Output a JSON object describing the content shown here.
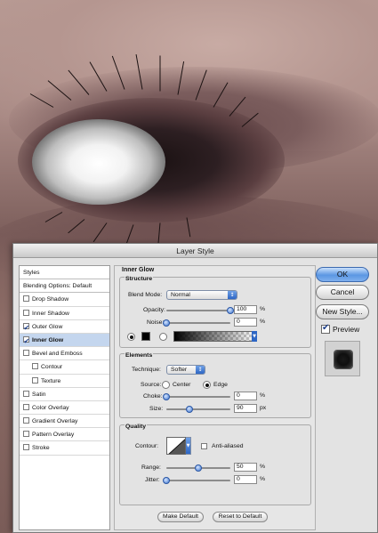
{
  "dialog": {
    "title": "Layer Style"
  },
  "styles_list": [
    {
      "label": "Styles",
      "type": "header",
      "checked": false
    },
    {
      "label": "Blending Options: Default",
      "type": "header",
      "checked": false
    },
    {
      "label": "Drop Shadow",
      "type": "item",
      "checked": false
    },
    {
      "label": "Inner Shadow",
      "type": "item",
      "checked": false
    },
    {
      "label": "Outer Glow",
      "type": "item",
      "checked": true
    },
    {
      "label": "Inner Glow",
      "type": "item",
      "checked": true,
      "selected": true
    },
    {
      "label": "Bevel and Emboss",
      "type": "item",
      "checked": false
    },
    {
      "label": "Contour",
      "type": "sub",
      "checked": false
    },
    {
      "label": "Texture",
      "type": "sub",
      "checked": false
    },
    {
      "label": "Satin",
      "type": "item",
      "checked": false
    },
    {
      "label": "Color Overlay",
      "type": "item",
      "checked": false
    },
    {
      "label": "Gradient Overlay",
      "type": "item",
      "checked": false
    },
    {
      "label": "Pattern Overlay",
      "type": "item",
      "checked": false
    },
    {
      "label": "Stroke",
      "type": "item",
      "checked": false
    }
  ],
  "panel": {
    "title": "Inner Glow",
    "structure": {
      "title": "Structure",
      "blend_mode_label": "Blend Mode:",
      "blend_mode_value": "Normal",
      "opacity_label": "Opacity:",
      "opacity_value": "100",
      "opacity_level": 1.0,
      "noise_label": "Noise:",
      "noise_value": "0",
      "noise_level": 0.0,
      "percent": "%",
      "glow_color": "#000000"
    },
    "elements": {
      "title": "Elements",
      "technique_label": "Technique:",
      "technique_value": "Softer",
      "source_label": "Source:",
      "source_center": "Center",
      "source_edge": "Edge",
      "source_selected": "Edge",
      "choke_label": "Choke:",
      "choke_value": "0",
      "choke_level": 0.0,
      "size_label": "Size:",
      "size_value": "90",
      "size_level": 0.36,
      "percent": "%",
      "px": "px"
    },
    "quality": {
      "title": "Quality",
      "contour_label": "Contour:",
      "anti_aliased_label": "Anti-aliased",
      "anti_aliased": false,
      "range_label": "Range:",
      "range_value": "50",
      "range_level": 0.5,
      "jitter_label": "Jitter:",
      "jitter_value": "0",
      "jitter_level": 0.0,
      "percent": "%"
    },
    "make_default": "Make Default",
    "reset_default": "Reset to Default"
  },
  "buttons": {
    "ok": "OK",
    "cancel": "Cancel",
    "new_style": "New Style...",
    "preview_label": "Preview",
    "preview_checked": true
  },
  "colors": {
    "accent": "#3d74cf",
    "selection": "#c4d6ee"
  }
}
